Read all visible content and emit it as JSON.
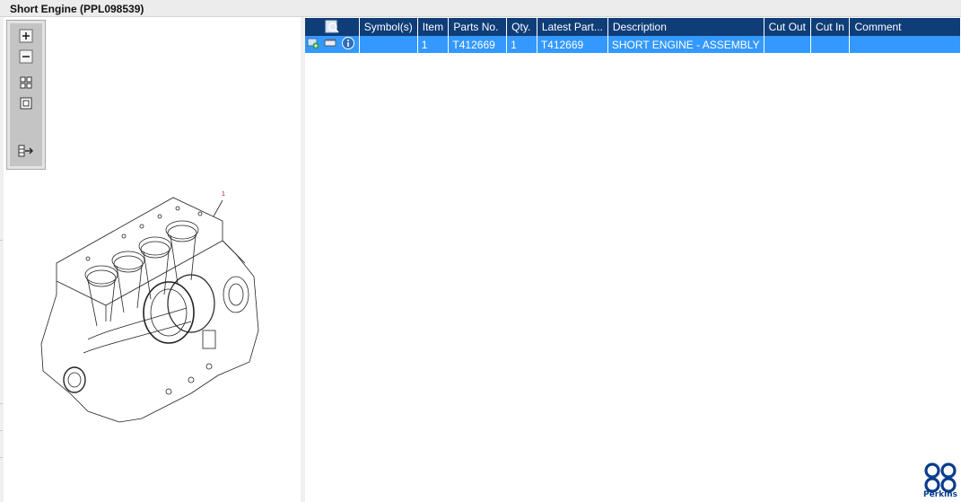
{
  "window": {
    "title": "Short Engine (PPL098539)"
  },
  "toolbar": {
    "buttons": [
      {
        "name": "zoom-in-icon"
      },
      {
        "name": "zoom-out-icon"
      },
      {
        "name": "fit-all-icon"
      },
      {
        "name": "fit-window-icon"
      },
      {
        "name": "export-icon"
      }
    ]
  },
  "drawing": {
    "callout": "1"
  },
  "table": {
    "headers": {
      "symbols": "Symbol(s)",
      "item": "Item",
      "parts_no": "Parts No.",
      "qty": "Qty.",
      "latest_part": "Latest Part...",
      "description": "Description",
      "cut_out": "Cut Out",
      "cut_in": "Cut In",
      "comment": "Comment"
    },
    "rows": [
      {
        "item": "1",
        "parts_no": "T412669",
        "qty": "1",
        "latest_part": "T412669",
        "description": "SHORT ENGINE - ASSEMBLY",
        "cut_out": "",
        "cut_in": "",
        "comment": ""
      }
    ]
  },
  "brand": {
    "name": "Perkins",
    "color": "#0a3c8c"
  },
  "colors": {
    "header": "#0f3d78",
    "selected_row": "#3399ff"
  }
}
